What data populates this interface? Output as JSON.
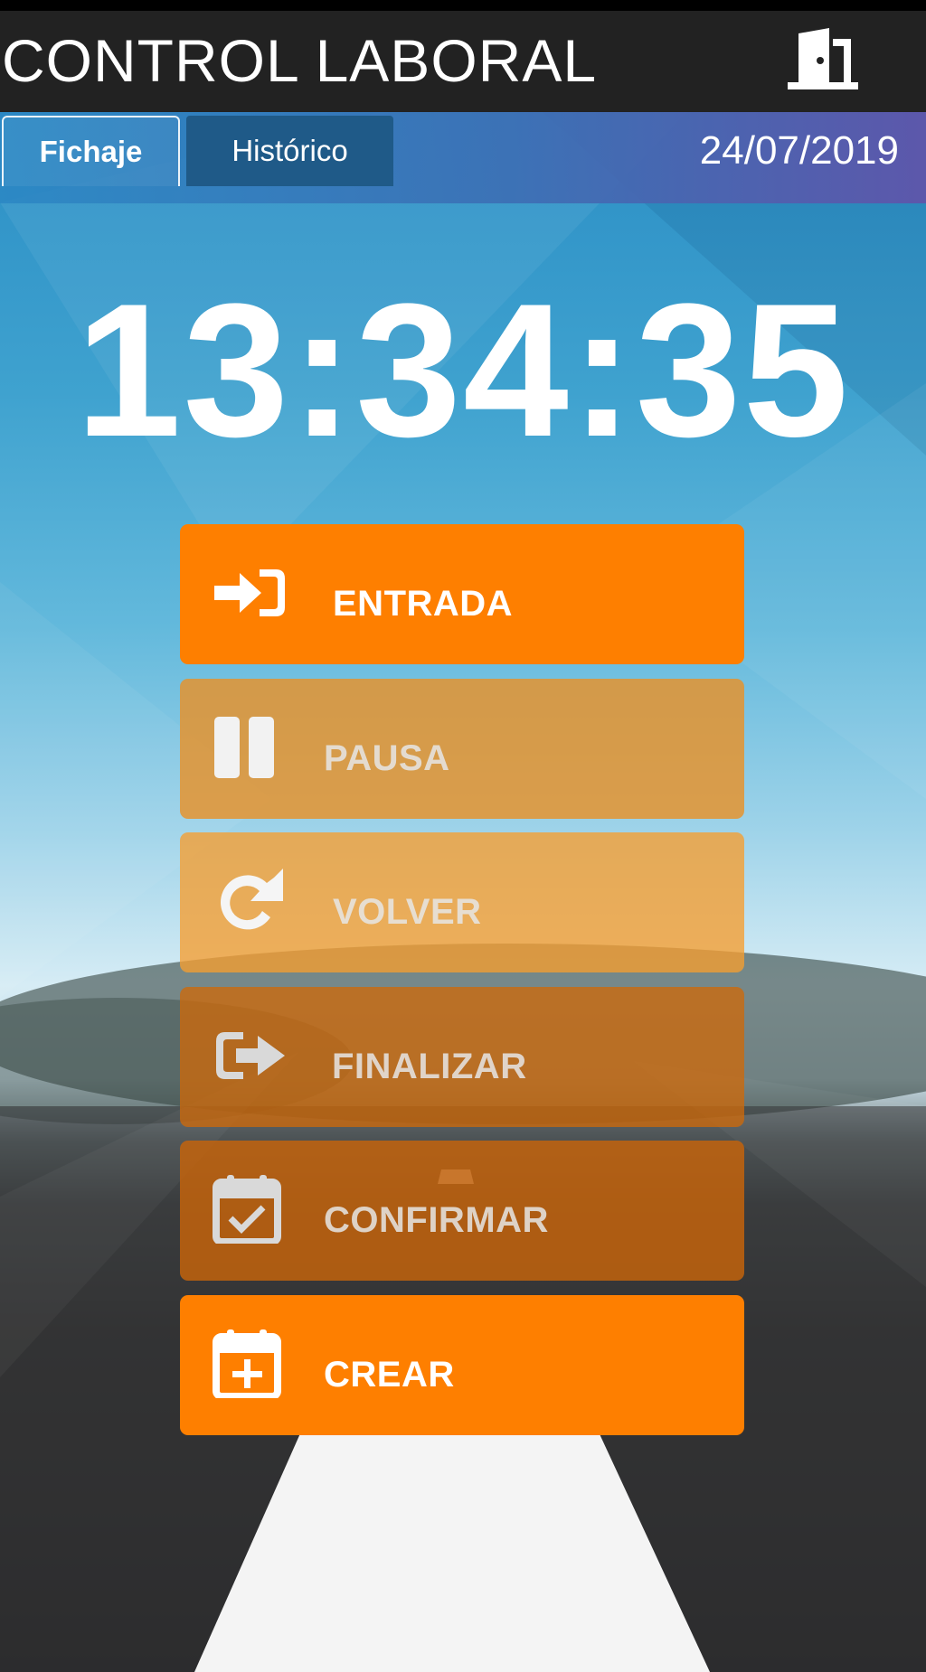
{
  "header": {
    "title": "CONTROL LABORAL",
    "exit_icon": "door-exit-icon"
  },
  "tabs": [
    {
      "label": "Fichaje",
      "active": true
    },
    {
      "label": "Histórico",
      "active": false
    }
  ],
  "date": "24/07/2019",
  "clock": "13:34:35",
  "actions": [
    {
      "label": "ENTRADA",
      "icon": "sign-in-icon",
      "enabled": true
    },
    {
      "label": "PAUSA",
      "icon": "pause-icon",
      "enabled": false
    },
    {
      "label": "VOLVER",
      "icon": "redo-icon",
      "enabled": false
    },
    {
      "label": "FINALIZAR",
      "icon": "sign-out-icon",
      "enabled": false
    },
    {
      "label": "CONFIRMAR",
      "icon": "calendar-check-icon",
      "enabled": false
    },
    {
      "label": "CREAR",
      "icon": "calendar-plus-icon",
      "enabled": true
    }
  ],
  "colors": {
    "app_bar": "#222222",
    "accent_orange": "#fe7f00",
    "text": "#ffffff"
  }
}
